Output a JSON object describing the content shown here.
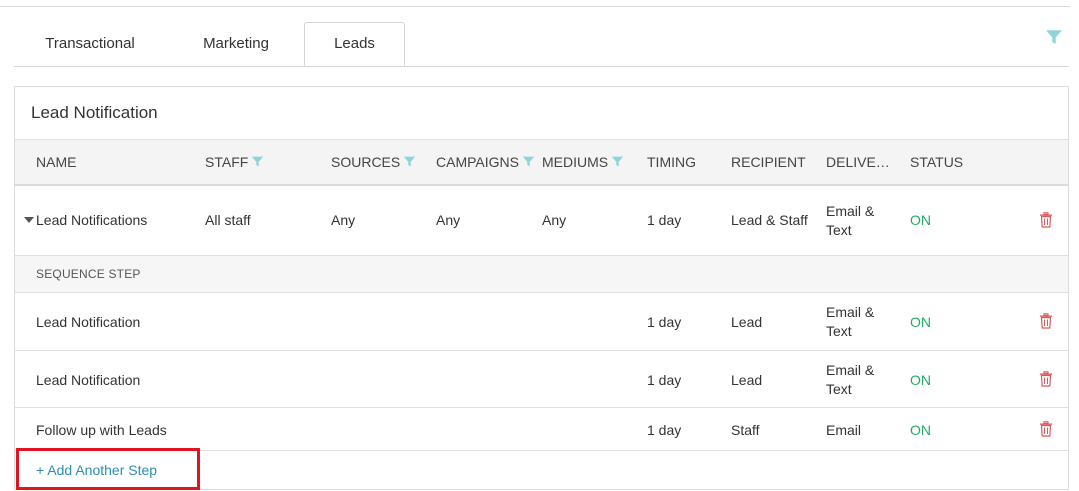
{
  "tabs": [
    {
      "label": "Transactional"
    },
    {
      "label": "Marketing"
    },
    {
      "label": "Leads",
      "active": true
    }
  ],
  "panel": {
    "title": "Lead Notification"
  },
  "columns": {
    "name": "NAME",
    "staff": "STAFF",
    "sources": "SOURCES",
    "campaigns": "CAMPAIGNS",
    "mediums": "MEDIUMS",
    "timing": "TIMING",
    "recipient": "RECIPIENT",
    "delivery": "DELIVE…",
    "status": "STATUS"
  },
  "main_row": {
    "name": "Lead Notifications",
    "staff": "All staff",
    "sources": "Any",
    "campaigns": "Any",
    "mediums": "Any",
    "timing": "1 day",
    "recipient": "Lead & Staff",
    "delivery": "Email & Text",
    "status": "ON"
  },
  "sequence_label": "SEQUENCE STEP",
  "steps": [
    {
      "name": "Lead Notification",
      "timing": "1 day",
      "recipient": "Lead",
      "delivery": "Email & Text",
      "status": "ON"
    },
    {
      "name": "Lead Notification",
      "timing": "1 day",
      "recipient": "Lead",
      "delivery": "Email & Text",
      "status": "ON"
    },
    {
      "name": "Follow up with Leads",
      "timing": "1 day",
      "recipient": "Staff",
      "delivery": "Email",
      "status": "ON"
    }
  ],
  "add_step_label": "+ Add Another Step",
  "colors": {
    "accent": "#2b8fb3",
    "on": "#1fae63",
    "trash": "#e0575b",
    "highlight": "#e0141e",
    "filter": "#8fd3dd"
  },
  "icons": {
    "filter": "filter-icon",
    "trash": "trash-icon",
    "caret": "caret-down-icon"
  }
}
